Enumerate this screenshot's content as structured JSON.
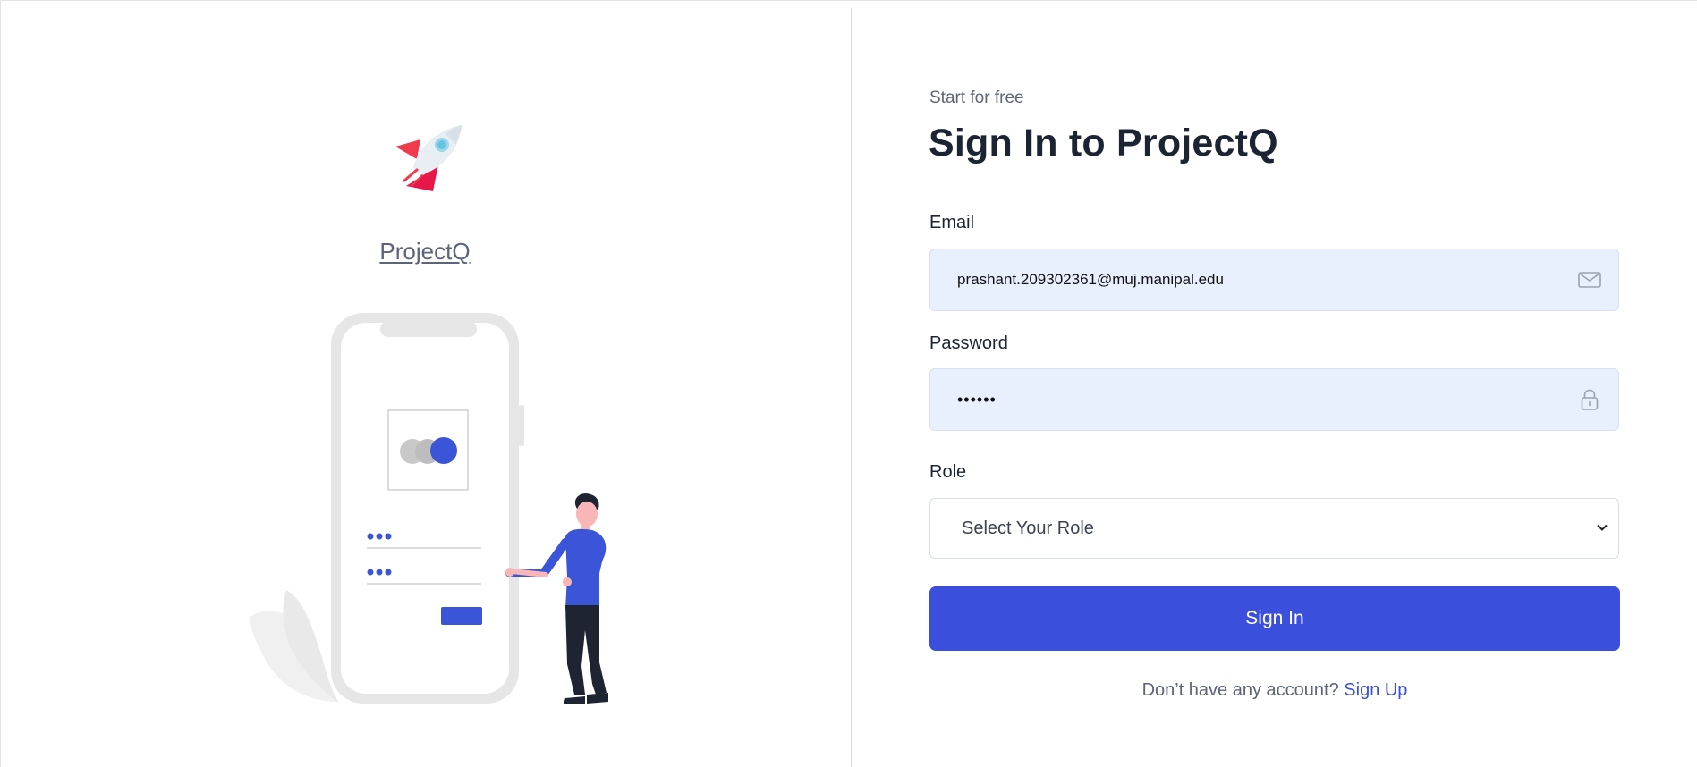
{
  "brand": {
    "name": "ProjectQ",
    "logo_icon": "rocket-icon"
  },
  "form": {
    "eyebrow": "Start for free",
    "title": "Sign In to ProjectQ",
    "email": {
      "label": "Email",
      "value": "prashant.209302361@muj.manipal.edu",
      "icon": "envelope-icon"
    },
    "password": {
      "label": "Password",
      "value": "••••••",
      "icon": "lock-icon"
    },
    "role": {
      "label": "Role",
      "selected": "Select Your Role"
    },
    "submit_label": "Sign In",
    "signup_prompt": "Don’t have any account?",
    "signup_link": "Sign Up"
  },
  "colors": {
    "accent": "#3b4fdd",
    "field_background": "#e8f0fe",
    "heading": "#1c2434",
    "muted": "#5b6478"
  }
}
